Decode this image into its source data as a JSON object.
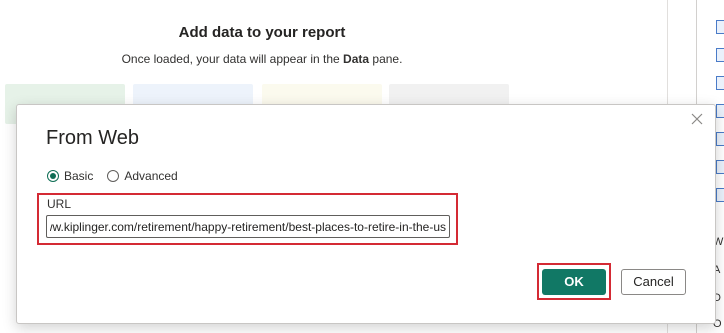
{
  "background": {
    "heading": "Add data to your report",
    "subtitle_prefix": "Once loaded, your data will appear in the ",
    "subtitle_bold": "Data",
    "subtitle_suffix": " pane."
  },
  "side_panel": {
    "text_items": [
      "W",
      "A",
      "D",
      "O"
    ]
  },
  "dialog": {
    "title": "From Web",
    "options": [
      {
        "label": "Basic",
        "selected": true
      },
      {
        "label": "Advanced",
        "selected": false
      }
    ],
    "url_label": "URL",
    "url_value": "https://www.kiplinger.com/retirement/happy-retirement/best-places-to-retire-in-the-us",
    "ok_label": "OK",
    "cancel_label": "Cancel"
  },
  "colors": {
    "accent": "#117865",
    "highlight": "#d42a34"
  }
}
